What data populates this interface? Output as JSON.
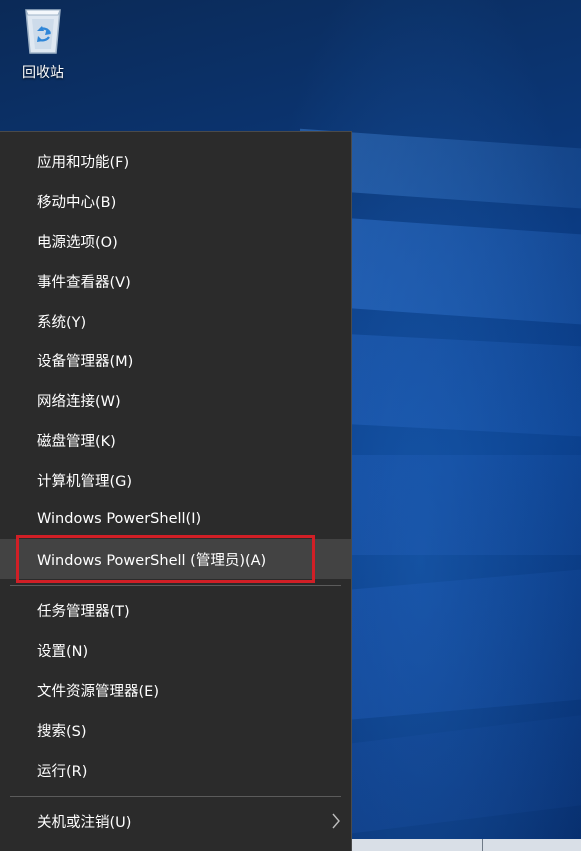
{
  "desktop": {
    "recycle_bin_label": "回收站"
  },
  "menu": {
    "items": [
      {
        "label": "应用和功能(F)"
      },
      {
        "label": "移动中心(B)"
      },
      {
        "label": "电源选项(O)"
      },
      {
        "label": "事件查看器(V)"
      },
      {
        "label": "系统(Y)"
      },
      {
        "label": "设备管理器(M)"
      },
      {
        "label": "网络连接(W)"
      },
      {
        "label": "磁盘管理(K)"
      },
      {
        "label": "计算机管理(G)"
      },
      {
        "label": "Windows PowerShell(I)"
      },
      {
        "label": "Windows PowerShell (管理员)(A)",
        "highlighted": true
      },
      {
        "label": "任务管理器(T)"
      },
      {
        "label": "设置(N)"
      },
      {
        "label": "文件资源管理器(E)"
      },
      {
        "label": "搜索(S)"
      },
      {
        "label": "运行(R)"
      },
      {
        "label": "关机或注销(U)",
        "has_submenu": true
      }
    ]
  },
  "annotation": {
    "highlight_color": "#d11f26"
  },
  "icons": {
    "recycle_bin": "recycle-bin-icon",
    "submenu_arrow": "chevron-right-icon"
  }
}
